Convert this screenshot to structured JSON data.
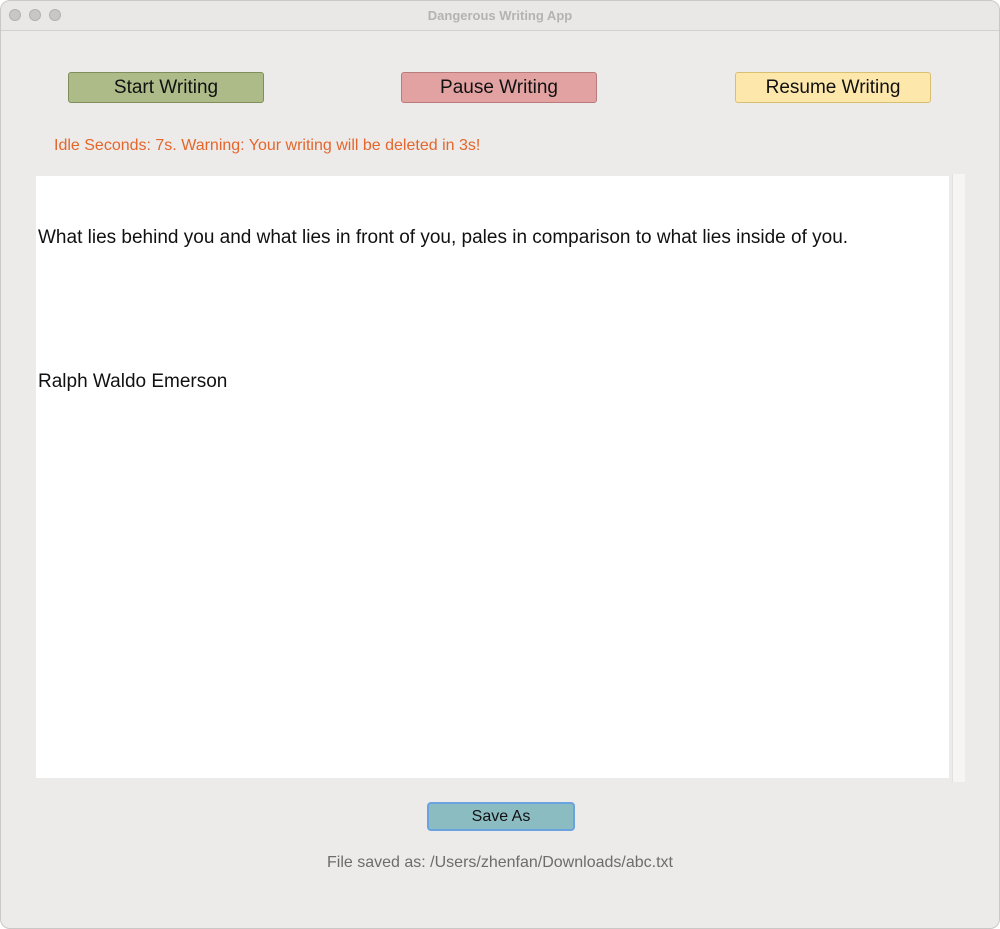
{
  "window": {
    "title": "Dangerous Writing App"
  },
  "toolbar": {
    "start_label": "Start Writing",
    "pause_label": "Pause Writing",
    "resume_label": "Resume Writing"
  },
  "status": {
    "warning_text": "Idle Seconds: 7s. Warning: Your writing will be deleted in 3s!"
  },
  "editor": {
    "lines": [
      "What lies behind you and what lies in front of you, pales in comparison to what lies inside of you.",
      "",
      "Ralph Waldo Emerson"
    ]
  },
  "footer": {
    "save_label": "Save As",
    "saved_message": "File saved as: /Users/zhenfan/Downloads/abc.txt"
  },
  "colors": {
    "start_button": "#acbb87",
    "pause_button": "#e2a2a2",
    "resume_button": "#fde7ab",
    "save_button": "#8bbcc2",
    "warning_text": "#e4662c"
  }
}
